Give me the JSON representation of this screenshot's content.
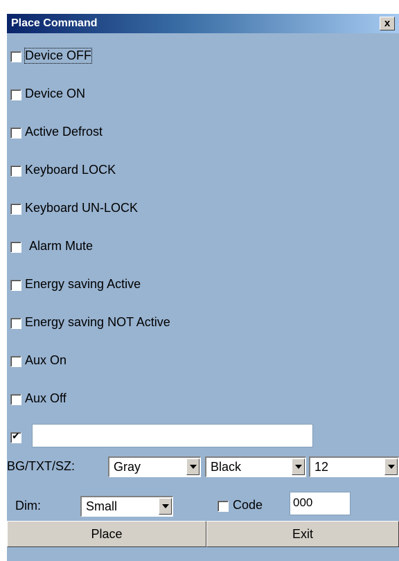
{
  "window": {
    "title": "Place Command",
    "close_label": "x"
  },
  "commands": [
    {
      "label": "Device OFF",
      "checked": false
    },
    {
      "label": "Device ON",
      "checked": false
    },
    {
      "label": "Active Defrost",
      "checked": false
    },
    {
      "label": "Keyboard LOCK",
      "checked": false
    },
    {
      "label": "Keyboard UN-LOCK",
      "checked": false
    },
    {
      "label": " Alarm Mute",
      "checked": false
    },
    {
      "label": "Energy saving Active",
      "checked": false
    },
    {
      "label": "Energy saving NOT Active",
      "checked": false
    },
    {
      "label": "Aux On",
      "checked": false
    },
    {
      "label": "Aux Off",
      "checked": false
    }
  ],
  "custom": {
    "checked": true,
    "check_glyph": "✔",
    "value": ""
  },
  "style_row": {
    "label": "BG/TXT/SZ:",
    "bg": "Gray",
    "txt": "Black",
    "size": "12"
  },
  "dim_row": {
    "label": "Dim:",
    "dim": "Small",
    "code_label": "Code",
    "code_checked": false,
    "code_value": "000"
  },
  "buttons": {
    "place": "Place",
    "exit": "Exit"
  }
}
